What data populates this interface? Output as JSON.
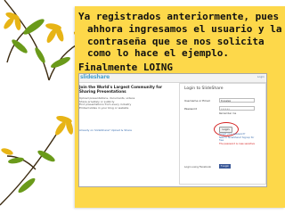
{
  "slide": {
    "text": "Ya registrados anteriormente, pues ahhora ingresamos  el usuario y la contraseña que se nos solicita como lo hace el ejemplo.",
    "final": "Finalmente LOING"
  },
  "screenshot": {
    "logo": "slideshare",
    "header_link": "Login",
    "heading": "Join the World's Largest Community for Sharing Presentations",
    "lines": [
      "Upload presentations, documents, videos",
      "Share privately or publicly",
      "Find presentations from every industry",
      "Embed slides in your blog or website"
    ],
    "bottom_note": "Already on SlideShare? Upload & Share",
    "login_title": "Login to SlideShare",
    "username_label": "Username or Email",
    "username_value": "tinoalex",
    "password_label": "Password",
    "password_value": "••••••",
    "remember": "Remember me",
    "login_button": "Login",
    "forgot": "Forgot your password?",
    "signup": "New to SlideShare? Signup for free",
    "note": "The password is case sensitive",
    "facebook_label": "Login using Facebook",
    "facebook_button": "f Login"
  },
  "colors": {
    "slide_background": "#fdd84a",
    "logo_blue": "#4da3cf",
    "highlight_red": "#d42020",
    "facebook_blue": "#3b5998"
  }
}
